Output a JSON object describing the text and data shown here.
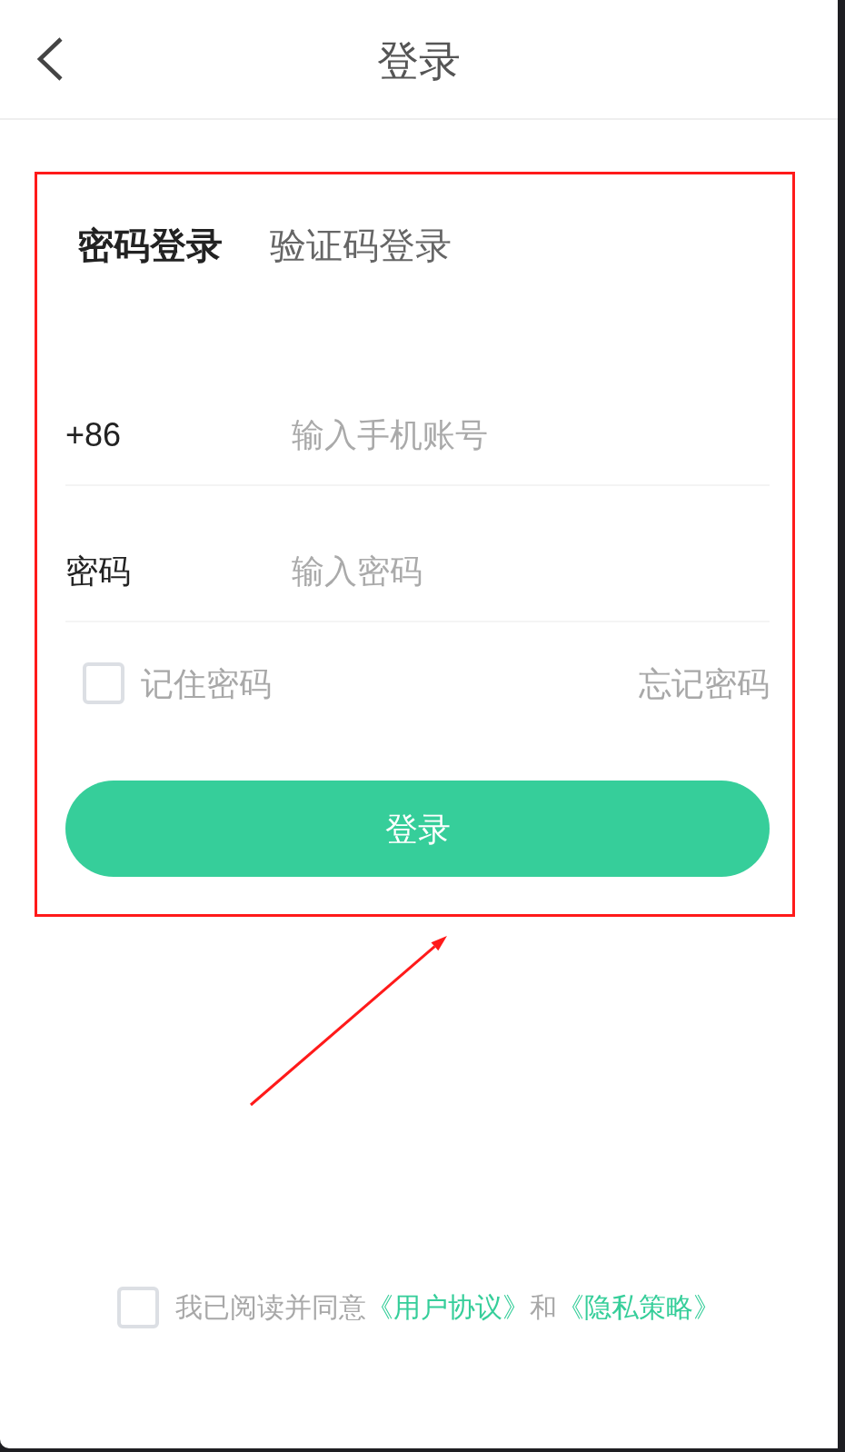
{
  "header": {
    "title": "登录"
  },
  "login_tabs": [
    {
      "label": "密码登录",
      "selected": true
    },
    {
      "label": "验证码登录",
      "selected": false
    }
  ],
  "fields": [
    {
      "label": "+86",
      "placeholder": "输入手机账号"
    },
    {
      "label": "密码",
      "placeholder": "输入密码"
    }
  ],
  "remember_password": {
    "label": "记住密码",
    "checked": false
  },
  "forgot_password": "忘记密码",
  "login_button": "登录",
  "agreement": {
    "checked": false,
    "parts": [
      {
        "kind": "text",
        "text": "我已阅读并同意"
      },
      {
        "kind": "link",
        "text": "《用户协议》"
      },
      {
        "kind": "text",
        "text": "和"
      },
      {
        "kind": "link",
        "text": "《隐私策略》"
      }
    ]
  },
  "annotation": {
    "highlight_box": true,
    "arrow": true
  }
}
